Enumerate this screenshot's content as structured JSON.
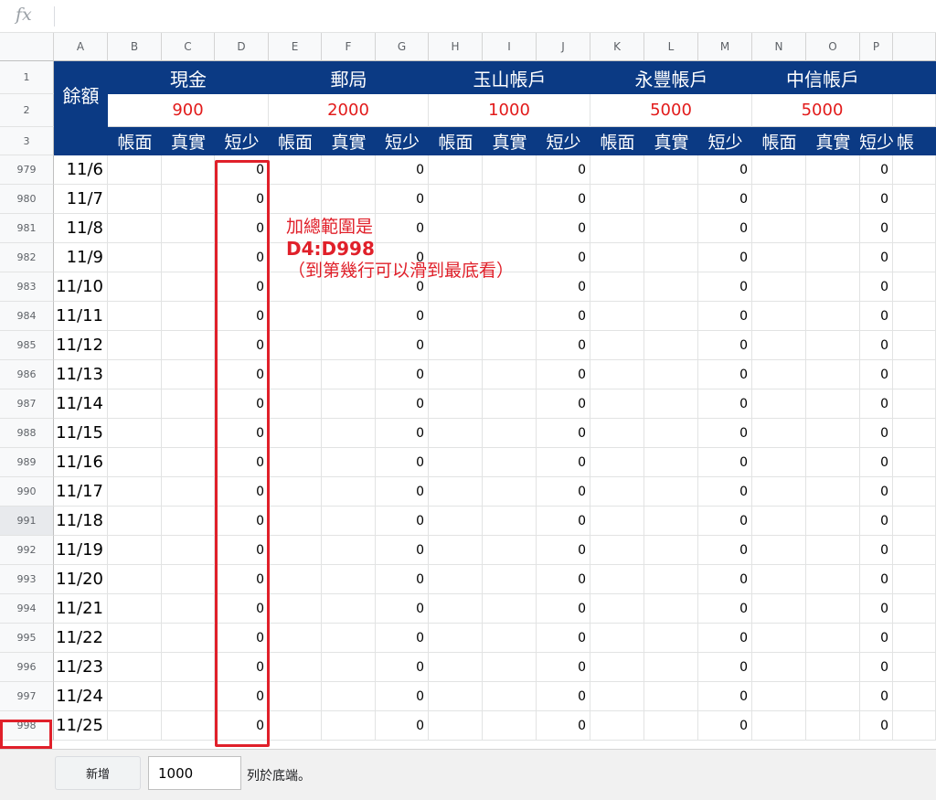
{
  "formula_bar": {
    "icon": "fx-icon",
    "fx_label": "fx",
    "value": ""
  },
  "column_headers": [
    "A",
    "B",
    "C",
    "D",
    "E",
    "F",
    "G",
    "H",
    "I",
    "J",
    "K",
    "L",
    "M",
    "N",
    "O",
    "P"
  ],
  "header_rows": [
    "1",
    "2",
    "3"
  ],
  "groups": [
    {
      "name": "現金",
      "balance": "900"
    },
    {
      "name": "郵局",
      "balance": "2000"
    },
    {
      "name": "玉山帳戶",
      "balance": "1000"
    },
    {
      "name": "永豐帳戶",
      "balance": "5000"
    },
    {
      "name": "中信帳戶",
      "balance": "5000"
    }
  ],
  "balance_label": "餘額",
  "sub_headers": [
    "帳面",
    "真實",
    "短少",
    "帳面",
    "真實",
    "短少",
    "帳面",
    "真實",
    "短少",
    "帳面",
    "真實",
    "短少",
    "帳面",
    "真實",
    "短少",
    "帳"
  ],
  "data_rows": [
    {
      "row": "979",
      "date": "11/6"
    },
    {
      "row": "980",
      "date": "11/7"
    },
    {
      "row": "981",
      "date": "11/8"
    },
    {
      "row": "982",
      "date": "11/9"
    },
    {
      "row": "983",
      "date": "11/10"
    },
    {
      "row": "984",
      "date": "11/11"
    },
    {
      "row": "985",
      "date": "11/12"
    },
    {
      "row": "986",
      "date": "11/13"
    },
    {
      "row": "987",
      "date": "11/14"
    },
    {
      "row": "988",
      "date": "11/15"
    },
    {
      "row": "989",
      "date": "11/16"
    },
    {
      "row": "990",
      "date": "11/17"
    },
    {
      "row": "991",
      "date": "11/18"
    },
    {
      "row": "992",
      "date": "11/19"
    },
    {
      "row": "993",
      "date": "11/20"
    },
    {
      "row": "994",
      "date": "11/21"
    },
    {
      "row": "995",
      "date": "11/22"
    },
    {
      "row": "996",
      "date": "11/23"
    },
    {
      "row": "997",
      "date": "11/24"
    },
    {
      "row": "998",
      "date": "11/25"
    }
  ],
  "shortage_value": "0",
  "highlighted_row": "991",
  "annotation": {
    "line1": "加總範圍是",
    "line2": "D4:D998",
    "line3": "（到第幾行可以滑到最底看）"
  },
  "bottom_bar": {
    "add_button": "新增",
    "rows_value": "1000",
    "suffix": "列於底端。"
  },
  "colors": {
    "header_blue": "#0b3a84",
    "balance_red": "#e21b1b",
    "annotation_red": "#e0202a"
  }
}
